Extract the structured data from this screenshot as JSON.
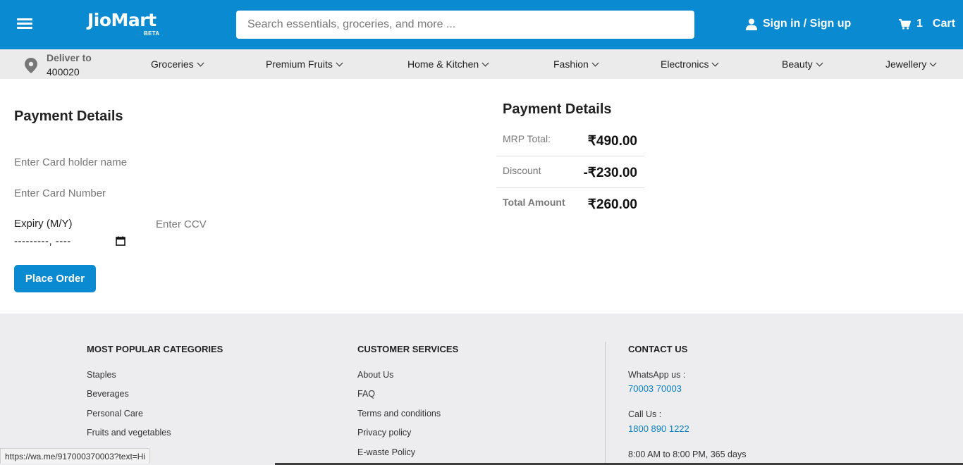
{
  "header": {
    "logo": "JioMart",
    "logo_badge": "BETA",
    "search_placeholder": "Search essentials, groceries, and more ...",
    "signin_label": "Sign in / Sign up",
    "cart_count": "1",
    "cart_label": "Cart",
    "brand_color": "#0a8ad0"
  },
  "delivery": {
    "label": "Deliver to",
    "pincode": "400020"
  },
  "categories": [
    "Groceries",
    "Premium Fruits",
    "Home & Kitchen",
    "Fashion",
    "Electronics",
    "Beauty",
    "Jewellery"
  ],
  "payment_form": {
    "title": "Payment Details",
    "card_holder_placeholder": "Enter Card holder name",
    "card_number_placeholder": "Enter Card Number",
    "expiry_label": "Expiry (M/Y)",
    "expiry_value": "---------, ----",
    "ccv_placeholder": "Enter CCV",
    "submit_label": "Place Order"
  },
  "summary": {
    "title": "Payment Details",
    "rows": [
      {
        "label": "MRP Total:",
        "value": "₹490.00"
      },
      {
        "label": "Discount",
        "value": "-₹230.00"
      },
      {
        "label": "Total Amount",
        "value": "₹260.00"
      }
    ]
  },
  "footer": {
    "popular": {
      "title": "MOST POPULAR CATEGORIES",
      "links": [
        "Staples",
        "Beverages",
        "Personal Care",
        "Fruits and vegetables"
      ]
    },
    "services": {
      "title": "CUSTOMER SERVICES",
      "links": [
        "About Us",
        "FAQ",
        "Terms and conditions",
        "Privacy policy",
        "E-waste Policy"
      ]
    },
    "contact": {
      "title": "CONTACT US",
      "whatsapp_label": "WhatsApp us :",
      "whatsapp_number": "70003 70003",
      "call_label": "Call Us :",
      "call_number": "1800 890 1222",
      "hours": "8:00 AM to 8:00 PM, 365 days"
    }
  },
  "status_url": "https://wa.me/917000370003?text=Hi"
}
